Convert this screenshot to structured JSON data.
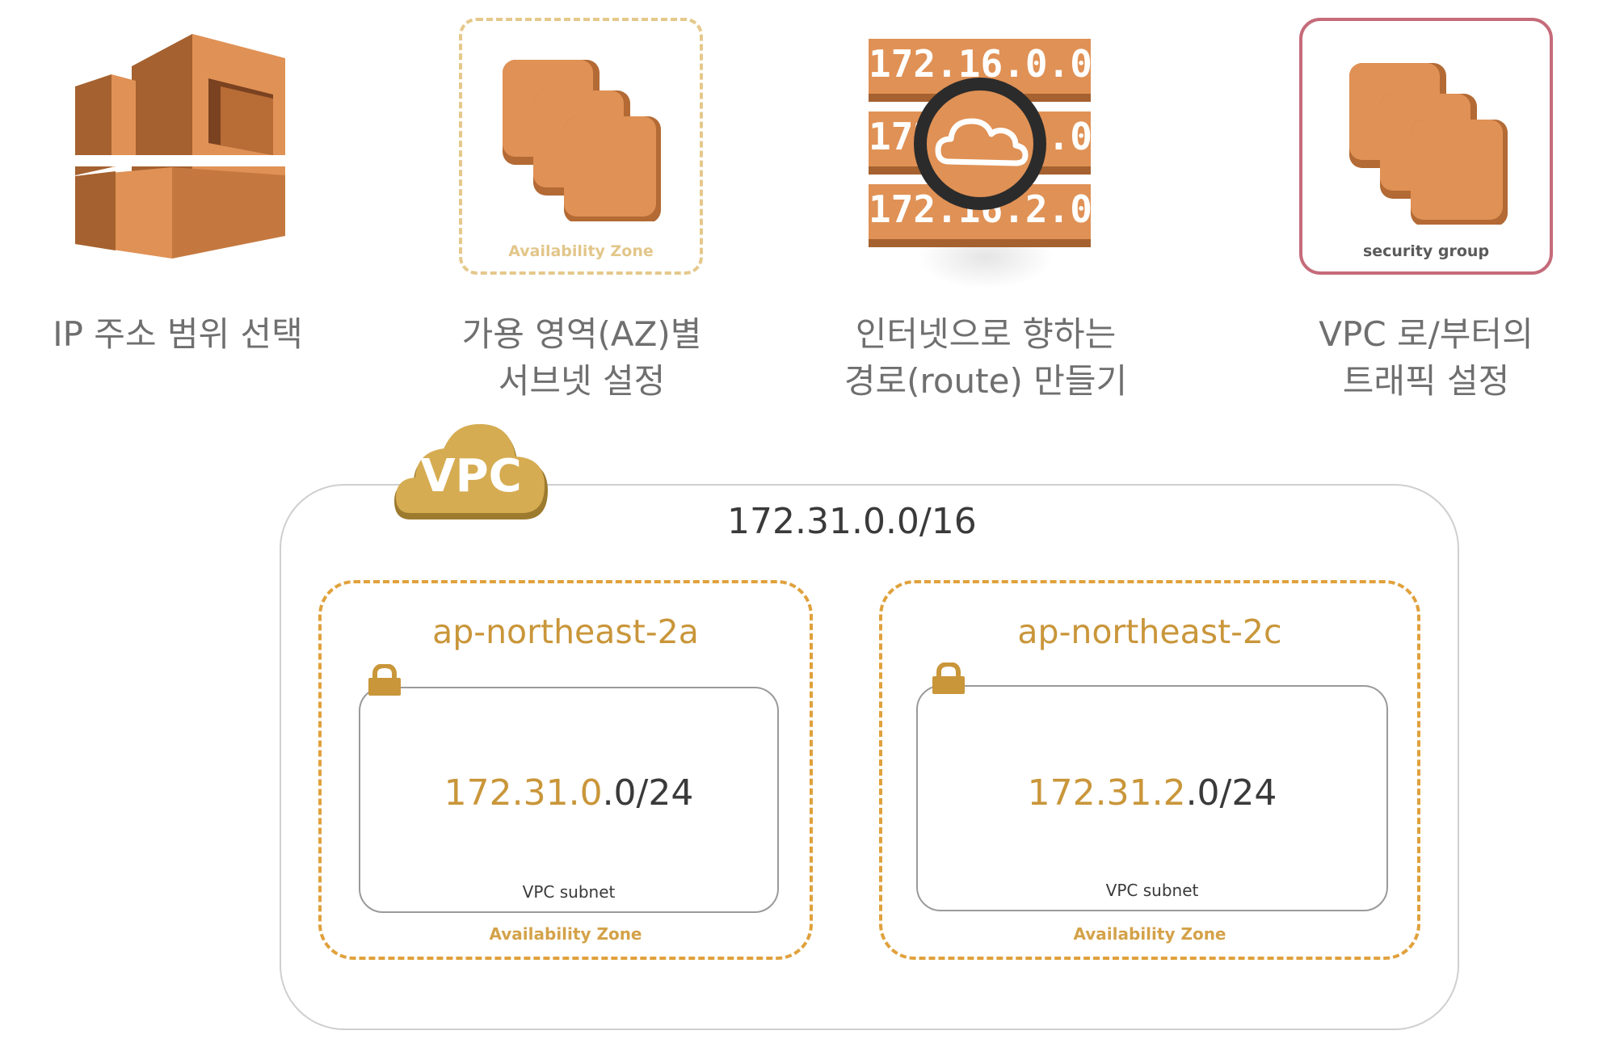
{
  "steps": [
    {
      "icon": "vpc-router-icon",
      "caption": "IP 주소 범위 선택"
    },
    {
      "icon": "availability-zone-icon",
      "icon_label": "Availability Zone",
      "caption": "가용 영역(AZ)별\n서브넷 설정"
    },
    {
      "icon": "route-table-icon",
      "ips": [
        "172.16.0.0",
        "172.16.1.0",
        "172.16.2.0"
      ],
      "caption": "인터넷으로 향하는\n경로(route) 만들기"
    },
    {
      "icon": "security-group-icon",
      "icon_label": "security group",
      "caption": "VPC 로/부터의\n트래픽 설정"
    }
  ],
  "vpc": {
    "badge": "VPC",
    "cidr": "172.31.0.0/16",
    "zones": [
      {
        "name": "ap-northeast-2a",
        "subnet_prefix": "172.31.0",
        "subnet_suffix": ".0/24",
        "subnet_label": "VPC subnet",
        "zone_label": "Availability Zone"
      },
      {
        "name": "ap-northeast-2c",
        "subnet_prefix": "172.31.2",
        "subnet_suffix": ".0/24",
        "subnet_label": "VPC subnet",
        "zone_label": "Availability Zone"
      }
    ]
  },
  "colors": {
    "aws_orange": "#e09155",
    "aws_orange_dark": "#9c5a2e",
    "gold": "#c9963a",
    "caption_gray": "#6f6f6f"
  }
}
